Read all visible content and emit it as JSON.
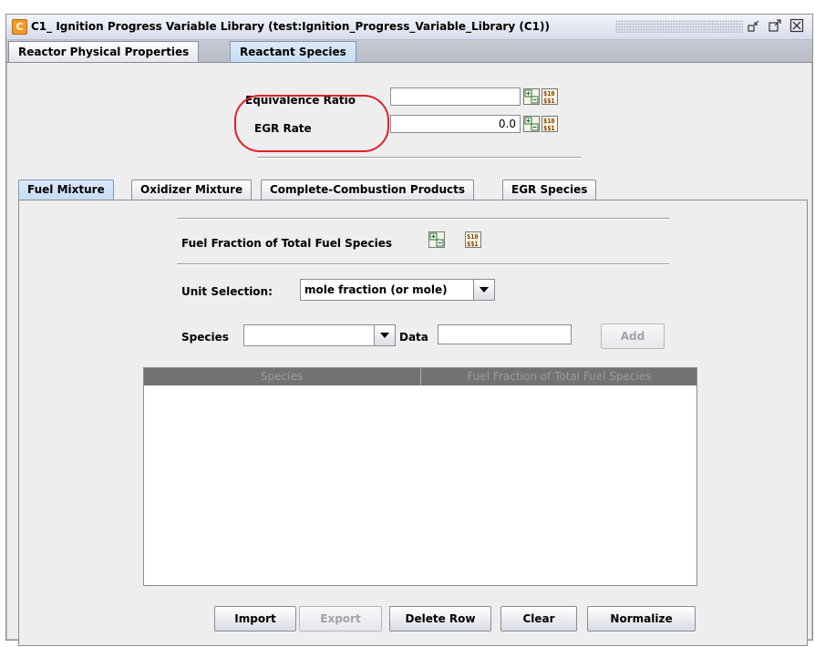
{
  "window": {
    "app_icon_letter": "C",
    "title": "C1_ Ignition Progress Variable Library  (test:Ignition_Progress_Variable_Library (C1))"
  },
  "top_tabs": [
    {
      "label": "Reactor Physical Properties",
      "selected": false
    },
    {
      "label": "Reactant Species",
      "selected": true
    }
  ],
  "params": {
    "equivalence_ratio_label": "Equivalence Ratio",
    "equivalence_ratio_value": "",
    "egr_rate_label": "EGR Rate",
    "egr_rate_value": "0.0"
  },
  "inner_tabs": [
    {
      "label": "Fuel Mixture",
      "selected": true
    },
    {
      "label": "Oxidizer Mixture",
      "selected": false
    },
    {
      "label": "Complete-Combustion Products",
      "selected": false
    },
    {
      "label": "EGR Species",
      "selected": false
    }
  ],
  "fuel": {
    "section_label": "Fuel Fraction of Total Fuel Species",
    "unit_label": "Unit Selection:",
    "unit_value": "mole fraction (or mole)",
    "species_label": "Species",
    "species_value": "",
    "data_label": "Data",
    "data_value": "",
    "add_label": "Add"
  },
  "table": {
    "columns": [
      "Species",
      "Fuel Fraction of Total Fuel Species"
    ],
    "rows": []
  },
  "buttons": {
    "import": "Import",
    "export": "Export",
    "delete_row": "Delete Row",
    "clear": "Clear",
    "normalize": "Normalize"
  },
  "colors": {
    "highlight": "#e0202a",
    "selected_tab": "#c7dcf2",
    "table_header": "#727272"
  }
}
